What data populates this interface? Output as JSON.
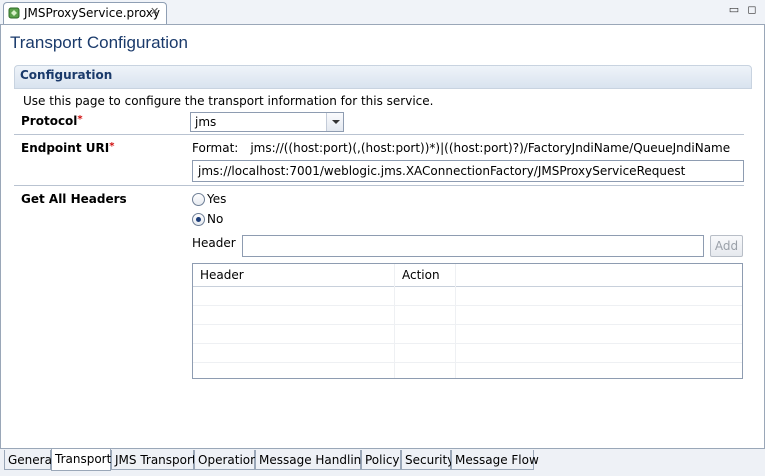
{
  "editor": {
    "tab_title": "JMSProxyService.proxy",
    "close_glyph": "✕",
    "minimize_glyph": "▭",
    "maximize_glyph": "◻"
  },
  "page": {
    "title": "Transport Configuration"
  },
  "section": {
    "title": "Configuration",
    "description": "Use this page to configure the transport information for this service."
  },
  "protocol": {
    "label": "Protocol",
    "required_mark": "*",
    "value": "jms"
  },
  "endpoint": {
    "label": "Endpoint URI",
    "required_mark": "*",
    "format_label": "Format:",
    "format_value": "jms://((host:port)(,(host:port))*)|((host:port)?)/FactoryJndiName/QueueJndiName",
    "value": "jms://localhost:7001/weblogic.jms.XAConnectionFactory/JMSProxyServiceRequest"
  },
  "headers": {
    "label": "Get All Headers",
    "yes_label": "Yes",
    "no_label": "No",
    "selected": "No",
    "header_field_label": "Header",
    "header_field_value": "",
    "add_label": "Add",
    "table": {
      "columns": [
        "Header",
        "Action",
        ""
      ],
      "rows": [
        [
          "",
          "",
          ""
        ],
        [
          "",
          "",
          ""
        ],
        [
          "",
          "",
          ""
        ],
        [
          "",
          "",
          ""
        ],
        [
          "",
          "",
          ""
        ]
      ]
    }
  },
  "bottom_tabs": [
    {
      "label": "General",
      "active": false
    },
    {
      "label": "Transport",
      "active": true
    },
    {
      "label": "JMS Transport",
      "active": false
    },
    {
      "label": "Operation",
      "active": false
    },
    {
      "label": "Message Handling",
      "active": false
    },
    {
      "label": "Policy",
      "active": false
    },
    {
      "label": "Security",
      "active": false
    },
    {
      "label": "Message Flow",
      "active": false
    }
  ],
  "colors": {
    "title_blue": "#1a3a6b",
    "required_red": "#d01010",
    "border": "#8e9cb1"
  }
}
